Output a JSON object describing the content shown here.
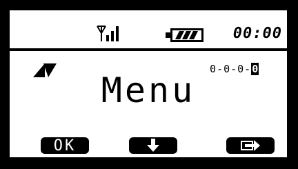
{
  "status_bar": {
    "signal_icon": "signal-antenna-icon",
    "battery_icon": "battery-full-icon",
    "clock": "00:00"
  },
  "main": {
    "scroll_icon": "up-down-triangles-icon",
    "code_digits": [
      "0",
      "0",
      "0",
      "0"
    ],
    "code_separator": "-",
    "active_digit_index": 3,
    "title": "Menu"
  },
  "softkeys": {
    "left_label": "OK",
    "center_icon": "arrow-down-icon",
    "right_icon": "arrow-enter-icon"
  },
  "colors": {
    "background": "#000000",
    "screen": "#ffffff",
    "ink": "#000000"
  }
}
